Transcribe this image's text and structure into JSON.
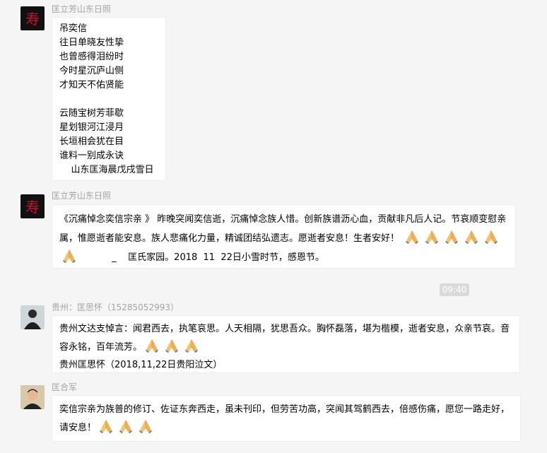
{
  "messages": [
    {
      "sender": "匡立芳山东日照",
      "lines": [
        "吊奕信",
        "往日单晓友性挚",
        "也曾感得泪纷时",
        "今时星沉庐山侧",
        "才知天不佑贤能",
        "",
        "云随宝树芳菲歇",
        "星划银河江浸月",
        "长垣相会犹在目",
        "谁料一别成永诀",
        "    山东匡海晨戊戌雪日"
      ]
    },
    {
      "sender": "匡立芳山东日照",
      "text1": "《沉痛悼念奕信宗亲 》 昨晚突闻奕信逝，沉痛悼念族人惜。创新族谱沥心血，贡献非凡后人记。节哀顺变慰亲属，惟愿逝者能安息。族人悲痛化力量，精诚团结弘遗志。愿逝者安息！生者安好！",
      "text2": "_    匡氏家园。2018  11  22日小雪时节，感恩节。"
    },
    {
      "time": "09:40"
    },
    {
      "sender": "贵州：匡思怀（15285052993）",
      "text1": "贵州文达支悼言：闻君西去，执笔哀思。人天相隔，犹思吾众。胸怀磊落，堪为楷模，逝者安息，众亲节哀。音容永铭，百年流芳。",
      "text2": "贵州匡思怀（2018,11,22日贵阳泣文）"
    },
    {
      "sender": "匡合军",
      "text1": "奕信宗亲为族普的修订、佐证东奔西走，虽未刊印，但劳苦功高，突闻其驾鹤西去，倍感伤痛，愿您一路走好，请安息！"
    }
  ],
  "icons": {
    "emoji": "folded-hands-icon"
  },
  "colors": {
    "background": "#f5f5f5",
    "sender": "#a3a3a3",
    "bubble": "#ffffff",
    "time_chip": "#dadada"
  }
}
